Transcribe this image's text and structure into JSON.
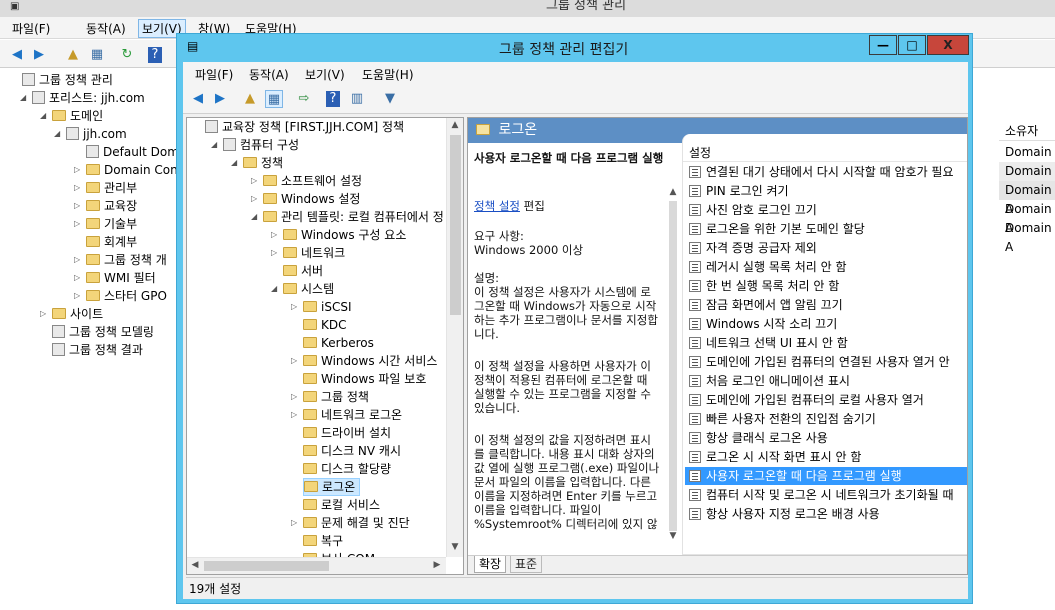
{
  "background_window": {
    "title": "그룹 정책 관리",
    "menu": [
      "파일(F)",
      "동작(A)",
      "보기(V)",
      "창(W)",
      "도움말(H)"
    ],
    "tree": [
      {
        "label": "그룹 정책 관리",
        "level": 0,
        "expander": "",
        "icon": "gpm"
      },
      {
        "label": "포리스트: jjh.com",
        "level": 1,
        "expander": "open",
        "icon": "forest"
      },
      {
        "label": "도메인",
        "level": 2,
        "expander": "open",
        "icon": "folder"
      },
      {
        "label": "jjh.com",
        "level": 3,
        "expander": "open",
        "icon": "domain"
      },
      {
        "label": "Default Dom",
        "level": 4,
        "expander": "",
        "icon": "gpo"
      },
      {
        "label": "Domain Con",
        "level": 4,
        "expander": "closed",
        "icon": "folder"
      },
      {
        "label": "관리부",
        "level": 4,
        "expander": "closed",
        "icon": "folder"
      },
      {
        "label": "교육장",
        "level": 4,
        "expander": "closed",
        "icon": "folder"
      },
      {
        "label": "기술부",
        "level": 4,
        "expander": "closed",
        "icon": "folder"
      },
      {
        "label": "회계부",
        "level": 4,
        "expander": "",
        "icon": "folder"
      },
      {
        "label": "그룹 정책 개",
        "level": 4,
        "expander": "closed",
        "icon": "folder"
      },
      {
        "label": "WMI 필터",
        "level": 4,
        "expander": "closed",
        "icon": "folder"
      },
      {
        "label": "스타터 GPO",
        "level": 4,
        "expander": "closed",
        "icon": "folder"
      },
      {
        "label": "사이트",
        "level": 2,
        "expander": "closed",
        "icon": "site"
      },
      {
        "label": "그룹 정책 모델링",
        "level": 2,
        "expander": "",
        "icon": "modeling"
      },
      {
        "label": "그룹 정책 결과",
        "level": 2,
        "expander": "",
        "icon": "results"
      }
    ],
    "right_header": "소유자",
    "right_rows": [
      "Domain A",
      "Domain A",
      "Domain A",
      "Domain A",
      "Domain A"
    ]
  },
  "editor": {
    "title": "그룹 정책 관리 편집기",
    "window_buttons": [
      "—",
      "□",
      "X"
    ],
    "menu": [
      "파일(F)",
      "동작(A)",
      "보기(V)",
      "도움말(H)"
    ],
    "toolbar": [
      "back-icon",
      "forward-icon",
      "up-folder-icon",
      "show-hide-tree-icon",
      "export-icon",
      "help-icon",
      "properties-icon",
      "filter-icon"
    ],
    "tree": [
      {
        "label": "교육장 정책 [FIRST.JJH.COM] 정책",
        "level": 0,
        "expander": "",
        "icon": "gpo"
      },
      {
        "label": "컴퓨터 구성",
        "level": 1,
        "expander": "open",
        "icon": "computer"
      },
      {
        "label": "정책",
        "level": 2,
        "expander": "open",
        "icon": "folder"
      },
      {
        "label": "소프트웨어 설정",
        "level": 3,
        "expander": "closed",
        "icon": "folder"
      },
      {
        "label": "Windows 설정",
        "level": 3,
        "expander": "closed",
        "icon": "folder"
      },
      {
        "label": "관리 템플릿: 로컬 컴퓨터에서 정",
        "level": 3,
        "expander": "open",
        "icon": "folder"
      },
      {
        "label": "Windows 구성 요소",
        "level": 4,
        "expander": "closed",
        "icon": "folder"
      },
      {
        "label": "네트워크",
        "level": 4,
        "expander": "closed",
        "icon": "folder"
      },
      {
        "label": "서버",
        "level": 4,
        "expander": "",
        "icon": "folder"
      },
      {
        "label": "시스템",
        "level": 4,
        "expander": "open",
        "icon": "folder-open"
      },
      {
        "label": "iSCSI",
        "level": 5,
        "expander": "closed",
        "icon": "folder"
      },
      {
        "label": "KDC",
        "level": 5,
        "expander": "",
        "icon": "folder"
      },
      {
        "label": "Kerberos",
        "level": 5,
        "expander": "",
        "icon": "folder"
      },
      {
        "label": "Windows 시간 서비스",
        "level": 5,
        "expander": "closed",
        "icon": "folder"
      },
      {
        "label": "Windows 파일 보호",
        "level": 5,
        "expander": "",
        "icon": "folder"
      },
      {
        "label": "그룹 정책",
        "level": 5,
        "expander": "closed",
        "icon": "folder"
      },
      {
        "label": "네트워크 로그온",
        "level": 5,
        "expander": "closed",
        "icon": "folder"
      },
      {
        "label": "드라이버 설치",
        "level": 5,
        "expander": "",
        "icon": "folder"
      },
      {
        "label": "디스크 NV 캐시",
        "level": 5,
        "expander": "",
        "icon": "folder"
      },
      {
        "label": "디스크 할당량",
        "level": 5,
        "expander": "",
        "icon": "folder"
      },
      {
        "label": "로그온",
        "level": 5,
        "expander": "",
        "icon": "folder",
        "selected": true
      },
      {
        "label": "로컬 서비스",
        "level": 5,
        "expander": "",
        "icon": "folder"
      },
      {
        "label": "문제 해결 및 진단",
        "level": 5,
        "expander": "closed",
        "icon": "folder"
      },
      {
        "label": "복구",
        "level": 5,
        "expander": "",
        "icon": "folder"
      },
      {
        "label": "보사 COM",
        "level": 5,
        "expander": "",
        "icon": "folder"
      }
    ],
    "right_header_title": "로그온",
    "detail": {
      "title": "사용자 로그온할 때 다음 프로그램 실행",
      "link": "정책 설정",
      "link_suffix": " 편집",
      "req_label": "요구 사항:",
      "req_value": "Windows 2000 이상",
      "desc_label": "설명:",
      "para1": "이 정책 설정은 사용자가 시스템에 로그온할 때 Windows가 자동으로 시작하는 추가 프로그램이나 문서를 지정합니다.",
      "para2": "이 정책 설정을 사용하면 사용자가 이 정책이 적용된 컴퓨터에 로그온할 때 실행할 수 있는 프로그램을 지정할 수 있습니다.",
      "para3": "이 정책 설정의 값을 지정하려면 표시를 클릭합니다. 내용 표시 대화 상자의 값 열에 실행 프로그램(.exe) 파일이나 문서 파일의 이름을 입력합니다. 다른 이름을 지정하려면 Enter 키를 누르고 이름을 입력합니다. 파일이 %Systemroot% 디렉터리에 있지 않"
    },
    "list_header": "설정",
    "settings": [
      "연결된 대기 상태에서 다시 시작할 때 암호가 필요",
      "PIN 로그인 켜기",
      "사진 암호 로그인 끄기",
      "로그온을 위한 기본 도메인 할당",
      "자격 증명 공급자 제외",
      "레거시 실행 목록 처리 안 함",
      "한 번 실행 목록 처리 안 함",
      "잠금 화면에서 앱 알림 끄기",
      "Windows 시작 소리 끄기",
      "네트워크 선택 UI 표시 안 함",
      "도메인에 가입된 컴퓨터의 연결된 사용자 열거 안",
      "처음 로그인 애니메이션 표시",
      "도메인에 가입된 컴퓨터의 로컬 사용자 열거",
      "빠른 사용자 전환의 진입점 숨기기",
      "항상 클래식 로그온 사용",
      "로그온 시 시작 화면 표시 안 함",
      "사용자 로그온할 때 다음 프로그램 실행",
      "컴퓨터 시작 및 로그온 시 네트워크가 초기화될 때",
      "항상 사용자 지정 로그온 배경 사용"
    ],
    "selected_setting_index": 16,
    "tabs": [
      "확장",
      "표준"
    ],
    "status": "19개 설정"
  }
}
